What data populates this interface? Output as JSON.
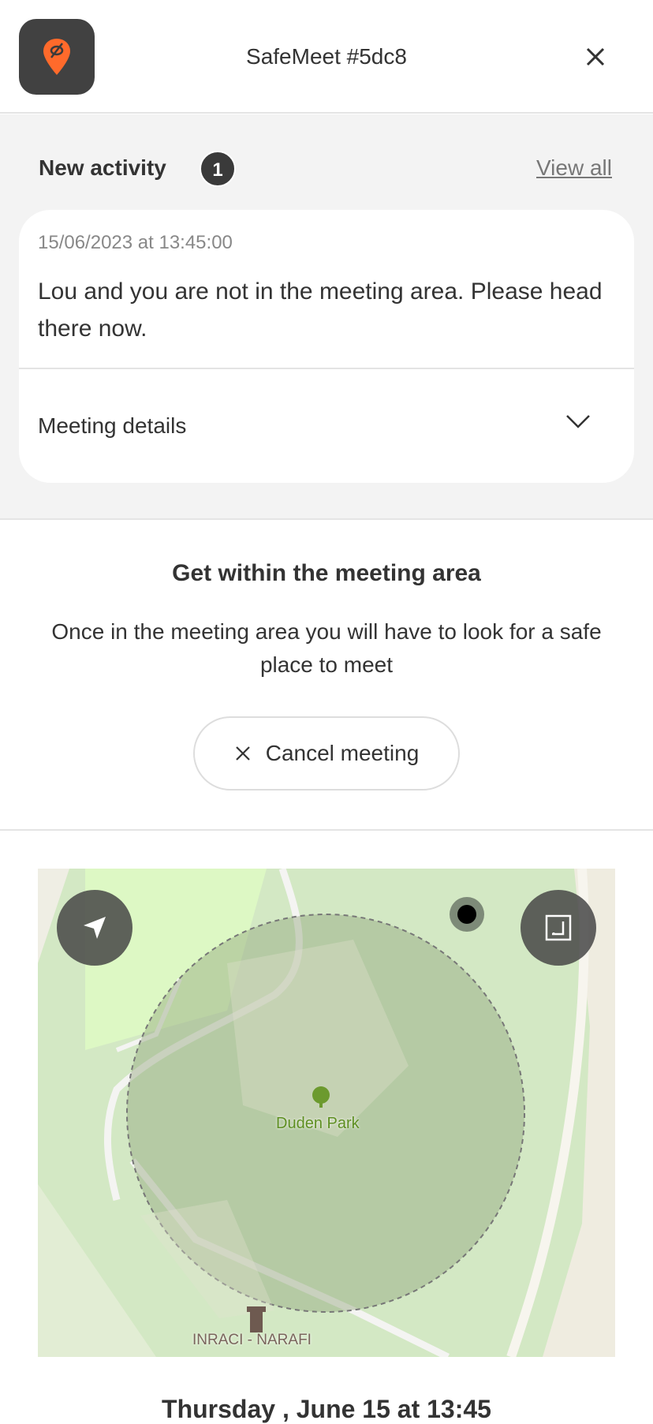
{
  "header": {
    "title": "SafeMeet #5dc8",
    "logo_icon": "eye-off-location-pin-icon",
    "close_icon": "close-icon",
    "brand_color": "#ff6a2b"
  },
  "activity": {
    "heading": "New activity",
    "count": "1",
    "view_all": "View all",
    "card": {
      "timestamp": "15/06/2023 at 13:45:00",
      "message": "Lou and you are not in the meeting area. Please head there now.",
      "details_label": "Meeting details"
    }
  },
  "instructions": {
    "title": "Get within the meeting area",
    "body": "Once in the meeting area you will have to look for a safe place to meet",
    "cancel_label": "Cancel meeting"
  },
  "map": {
    "park_label": "Duden Park",
    "poi_label": "INRACI - NARAFI",
    "locate_icon": "navigation-arrow-icon",
    "expand_icon": "expand-icon"
  },
  "meeting": {
    "date": "Thursday , June 15 at 13:45"
  }
}
